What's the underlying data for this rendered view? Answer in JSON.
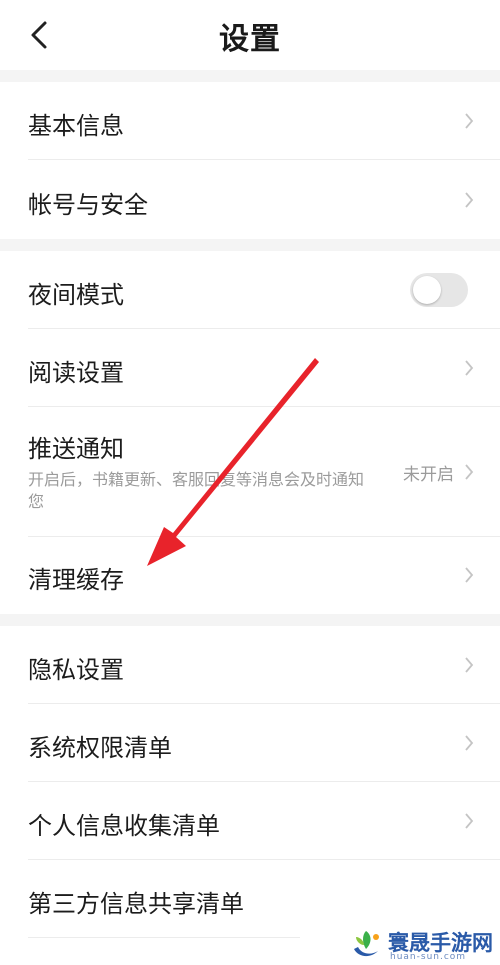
{
  "header": {
    "title": "设置",
    "back_icon": "chevron-left-icon"
  },
  "groups": [
    {
      "items": [
        {
          "label": "基本信息",
          "type": "link"
        },
        {
          "label": "帐号与安全",
          "type": "link"
        }
      ]
    },
    {
      "items": [
        {
          "label": "夜间模式",
          "type": "toggle",
          "enabled": false
        },
        {
          "label": "阅读设置",
          "type": "link"
        },
        {
          "label": "推送通知",
          "type": "link",
          "description": "开启后，书籍更新、客服回复等消息会及时通知您",
          "status": "未开启"
        },
        {
          "label": "清理缓存",
          "type": "link"
        }
      ]
    },
    {
      "items": [
        {
          "label": "隐私设置",
          "type": "link"
        },
        {
          "label": "系统权限清单",
          "type": "link"
        },
        {
          "label": "个人信息收集清单",
          "type": "link"
        },
        {
          "label": "第三方信息共享清单",
          "type": "link"
        }
      ]
    }
  ],
  "annotation": {
    "color": "#e8232b"
  },
  "watermark": {
    "name": "寰晟手游网",
    "domain": "huan-sun.com"
  }
}
